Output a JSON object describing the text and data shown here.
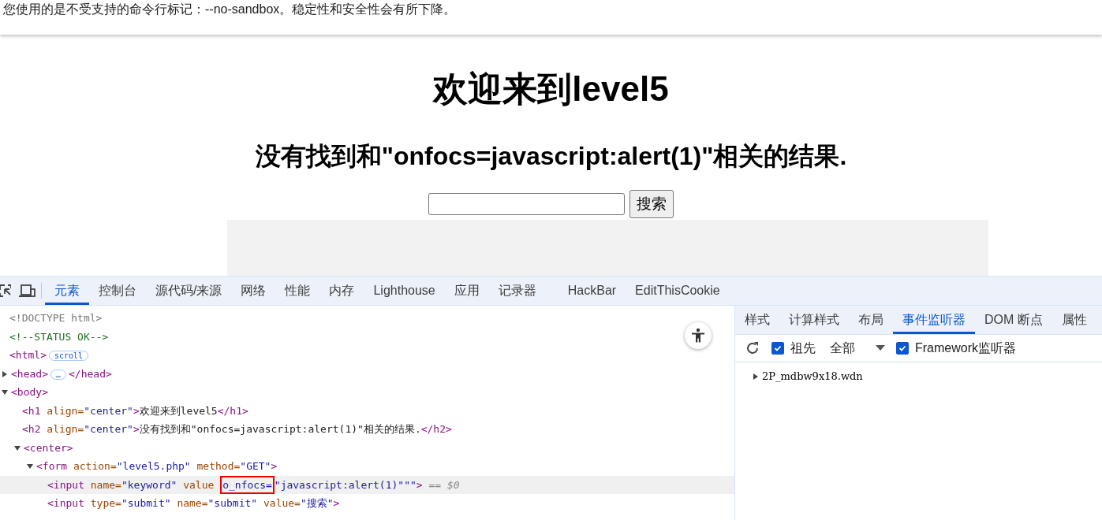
{
  "banner": {
    "text": "您使用的是不受支持的命令行标记：--no-sandbox。稳定性和安全性会有所下降。"
  },
  "page": {
    "heading": "欢迎来到level5",
    "subheading": "没有找到和\"onfocs=javascript:alert(1)\"相关的结果.",
    "search": {
      "button": "搜索"
    }
  },
  "devtools": {
    "tabs": [
      {
        "label": "元素",
        "selected": true
      },
      {
        "label": "控制台",
        "selected": false
      },
      {
        "label": "源代码/来源",
        "selected": false
      },
      {
        "label": "网络",
        "selected": false
      },
      {
        "label": "性能",
        "selected": false
      },
      {
        "label": "内存",
        "selected": false
      },
      {
        "label": "Lighthouse",
        "selected": false
      },
      {
        "label": "应用",
        "selected": false
      },
      {
        "label": "记录器",
        "selected": false
      },
      {
        "label": "HackBar",
        "selected": false
      },
      {
        "label": "EditThisCookie",
        "selected": false
      }
    ],
    "dom": [
      {
        "parts": [
          {
            "kind": "doctype",
            "text": "<!DOCTYPE html>"
          }
        ]
      },
      {
        "parts": [
          {
            "kind": "comment",
            "text": "<!--STATUS OK-->"
          }
        ]
      },
      {
        "parts": [
          {
            "kind": "tag",
            "text": "<html>"
          },
          {
            "kind": "badge",
            "text": "scroll"
          }
        ]
      },
      {
        "expanded": false,
        "parts": [
          {
            "kind": "tag",
            "text": "<head>"
          },
          {
            "kind": "badge",
            "text": "…"
          },
          {
            "kind": "tag",
            "text": "</head>"
          }
        ]
      },
      {
        "expanded": true,
        "parts": [
          {
            "kind": "tag",
            "text": "<body>"
          }
        ],
        "children": [
          {
            "parts": [
              {
                "kind": "tag",
                "text": "<h1 "
              },
              {
                "kind": "attr",
                "text": "align="
              },
              {
                "kind": "value",
                "text": "\"center\""
              },
              {
                "kind": "tag",
                "text": ">"
              },
              {
                "kind": "text",
                "text": "欢迎来到level5"
              },
              {
                "kind": "tag",
                "text": "</h1>"
              }
            ]
          },
          {
            "parts": [
              {
                "kind": "tag",
                "text": "<h2 "
              },
              {
                "kind": "attr",
                "text": "align="
              },
              {
                "kind": "value",
                "text": "\"center\""
              },
              {
                "kind": "tag",
                "text": ">"
              },
              {
                "kind": "text",
                "text": "没有找到和\"onfocs=javascript:alert(1)\"相关的结果."
              },
              {
                "kind": "tag",
                "text": "</h2>"
              }
            ]
          },
          {
            "expanded": true,
            "parts": [
              {
                "kind": "tag",
                "text": "<center>"
              }
            ],
            "children": [
              {
                "expanded": true,
                "parts": [
                  {
                    "kind": "tag",
                    "text": "<form "
                  },
                  {
                    "kind": "attr",
                    "text": "action="
                  },
                  {
                    "kind": "value",
                    "text": "\"level5.php\" "
                  },
                  {
                    "kind": "attr",
                    "text": "method="
                  },
                  {
                    "kind": "value",
                    "text": "\"GET\""
                  },
                  {
                    "kind": "tag",
                    "text": ">"
                  }
                ],
                "children": [
                  {
                    "selected": true,
                    "parts": [
                      {
                        "kind": "tag",
                        "text": "<input "
                      },
                      {
                        "kind": "attr",
                        "text": "name="
                      },
                      {
                        "kind": "value",
                        "text": "\"keyword\" "
                      },
                      {
                        "kind": "attr",
                        "text": "value "
                      },
                      {
                        "kind": "boxed",
                        "text": "o_nfocs="
                      },
                      {
                        "kind": "value",
                        "text": "\"javascript:alert(1)\"\"\""
                      },
                      {
                        "kind": "tag",
                        "text": ">"
                      },
                      {
                        "kind": "console",
                        "text": " == $0"
                      }
                    ]
                  },
                  {
                    "selected": false,
                    "parts": [
                      {
                        "kind": "tag",
                        "text": "<input "
                      },
                      {
                        "kind": "attr",
                        "text": "type="
                      },
                      {
                        "kind": "value",
                        "text": "\"submit\" "
                      },
                      {
                        "kind": "attr",
                        "text": "name="
                      },
                      {
                        "kind": "value",
                        "text": "\"submit\" "
                      },
                      {
                        "kind": "attr",
                        "text": "value="
                      },
                      {
                        "kind": "value",
                        "text": "\"搜索\""
                      },
                      {
                        "kind": "tag",
                        "text": ">"
                      }
                    ]
                  }
                ]
              }
            ]
          }
        ]
      }
    ],
    "side_tabs": [
      {
        "label": "样式",
        "selected": false
      },
      {
        "label": "计算样式",
        "selected": false
      },
      {
        "label": "布局",
        "selected": false
      },
      {
        "label": "事件监听器",
        "selected": true
      },
      {
        "label": "DOM 断点",
        "selected": false
      },
      {
        "label": "属性",
        "selected": false
      }
    ],
    "toolbar": {
      "ancestors": {
        "label": "祖先",
        "checked": true
      },
      "filter": "全部",
      "framework": {
        "label": "Framework监听器",
        "checked": true
      }
    },
    "listeners": [
      {
        "label": "2P_mdbw9x18.wdn",
        "expanded": false
      }
    ]
  }
}
